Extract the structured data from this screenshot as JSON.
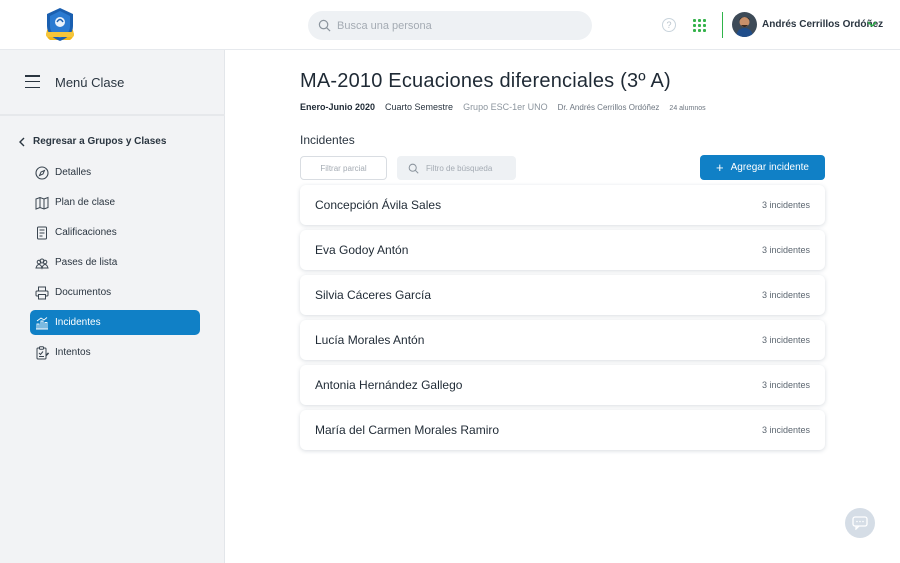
{
  "header": {
    "search_placeholder": "Busca una persona",
    "help_glyph": "?",
    "user_name": "Andrés Cerrillos Ordóñez"
  },
  "sidebar": {
    "menu_title": "Menú Clase",
    "back_label": "Regresar a Grupos y Clases",
    "items": [
      {
        "label": "Detalles",
        "icon": "compass-icon"
      },
      {
        "label": "Plan de clase",
        "icon": "map-icon"
      },
      {
        "label": "Calificaciones",
        "icon": "grades-icon"
      },
      {
        "label": "Pases de lista",
        "icon": "group-icon"
      },
      {
        "label": "Documentos",
        "icon": "printer-icon"
      },
      {
        "label": "Incidentes",
        "icon": "chart-icon",
        "active": true
      },
      {
        "label": "Intentos",
        "icon": "clipboard-icon"
      }
    ]
  },
  "course": {
    "title": "MA-2010 Ecuaciones diferenciales (3º A)",
    "period": "Enero-Junio 2020",
    "semester": "Cuarto Semestre",
    "group": "Grupo ESC-1er UNO",
    "professor": "Dr. Andrés Cerrillos Ordóñez",
    "students": "24 alumnos"
  },
  "incidents": {
    "section_title": "Incidentes",
    "filter_partial": "Filtrar parcial",
    "filter_search": "Filtro de búsqueda",
    "add_label": "Agregar incidente",
    "rows": [
      {
        "name": "Concepción Ávila Sales",
        "count": "3 incidentes"
      },
      {
        "name": "Eva Godoy Antón",
        "count": "3 incidentes"
      },
      {
        "name": "Silvia Cáceres García",
        "count": "3 incidentes"
      },
      {
        "name": "Lucía Morales Antón",
        "count": "3 incidentes"
      },
      {
        "name": "Antonia Hernández Gallego",
        "count": "3 incidentes"
      },
      {
        "name": "María del Carmen Morales Ramiro",
        "count": "3 incidentes"
      }
    ]
  },
  "colors": {
    "accent": "#1080c6",
    "green": "#34b24a",
    "sidebar_bg": "#f2f3f5"
  }
}
